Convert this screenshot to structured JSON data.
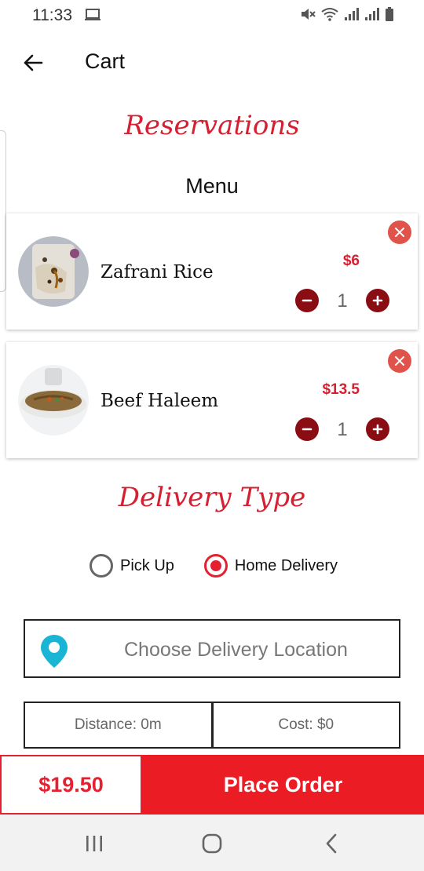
{
  "status_bar": {
    "time": "11:33"
  },
  "header": {
    "title": "Cart"
  },
  "reservations": {
    "heading": "Reservations",
    "menu_label": "Menu"
  },
  "cart_items": [
    {
      "name": "Zafrani Rice",
      "price": "$6",
      "quantity": "1"
    },
    {
      "name": "Beef Haleem",
      "price": "$13.5",
      "quantity": "1"
    }
  ],
  "delivery": {
    "heading": "Delivery Type",
    "options": [
      {
        "label": "Pick Up",
        "selected": false
      },
      {
        "label": "Home Delivery",
        "selected": true
      }
    ],
    "location_placeholder": "Choose Delivery Location",
    "distance": "Distance: 0m",
    "cost": "Cost: $0"
  },
  "order": {
    "total": "$19.50",
    "place_order_label": "Place Order"
  },
  "colors": {
    "accent": "#ec1c24",
    "script_red": "#d42030",
    "stepper": "#8b0d14",
    "remove": "#e0534a",
    "location_pin": "#1ab5d4"
  },
  "icons": {
    "back": "arrow-left-icon",
    "remove": "close-icon",
    "minus": "minus-icon",
    "plus": "plus-icon",
    "location": "map-pin-icon",
    "nav_recent": "recent-apps-icon",
    "nav_home": "home-icon",
    "nav_back": "chevron-left-icon"
  }
}
